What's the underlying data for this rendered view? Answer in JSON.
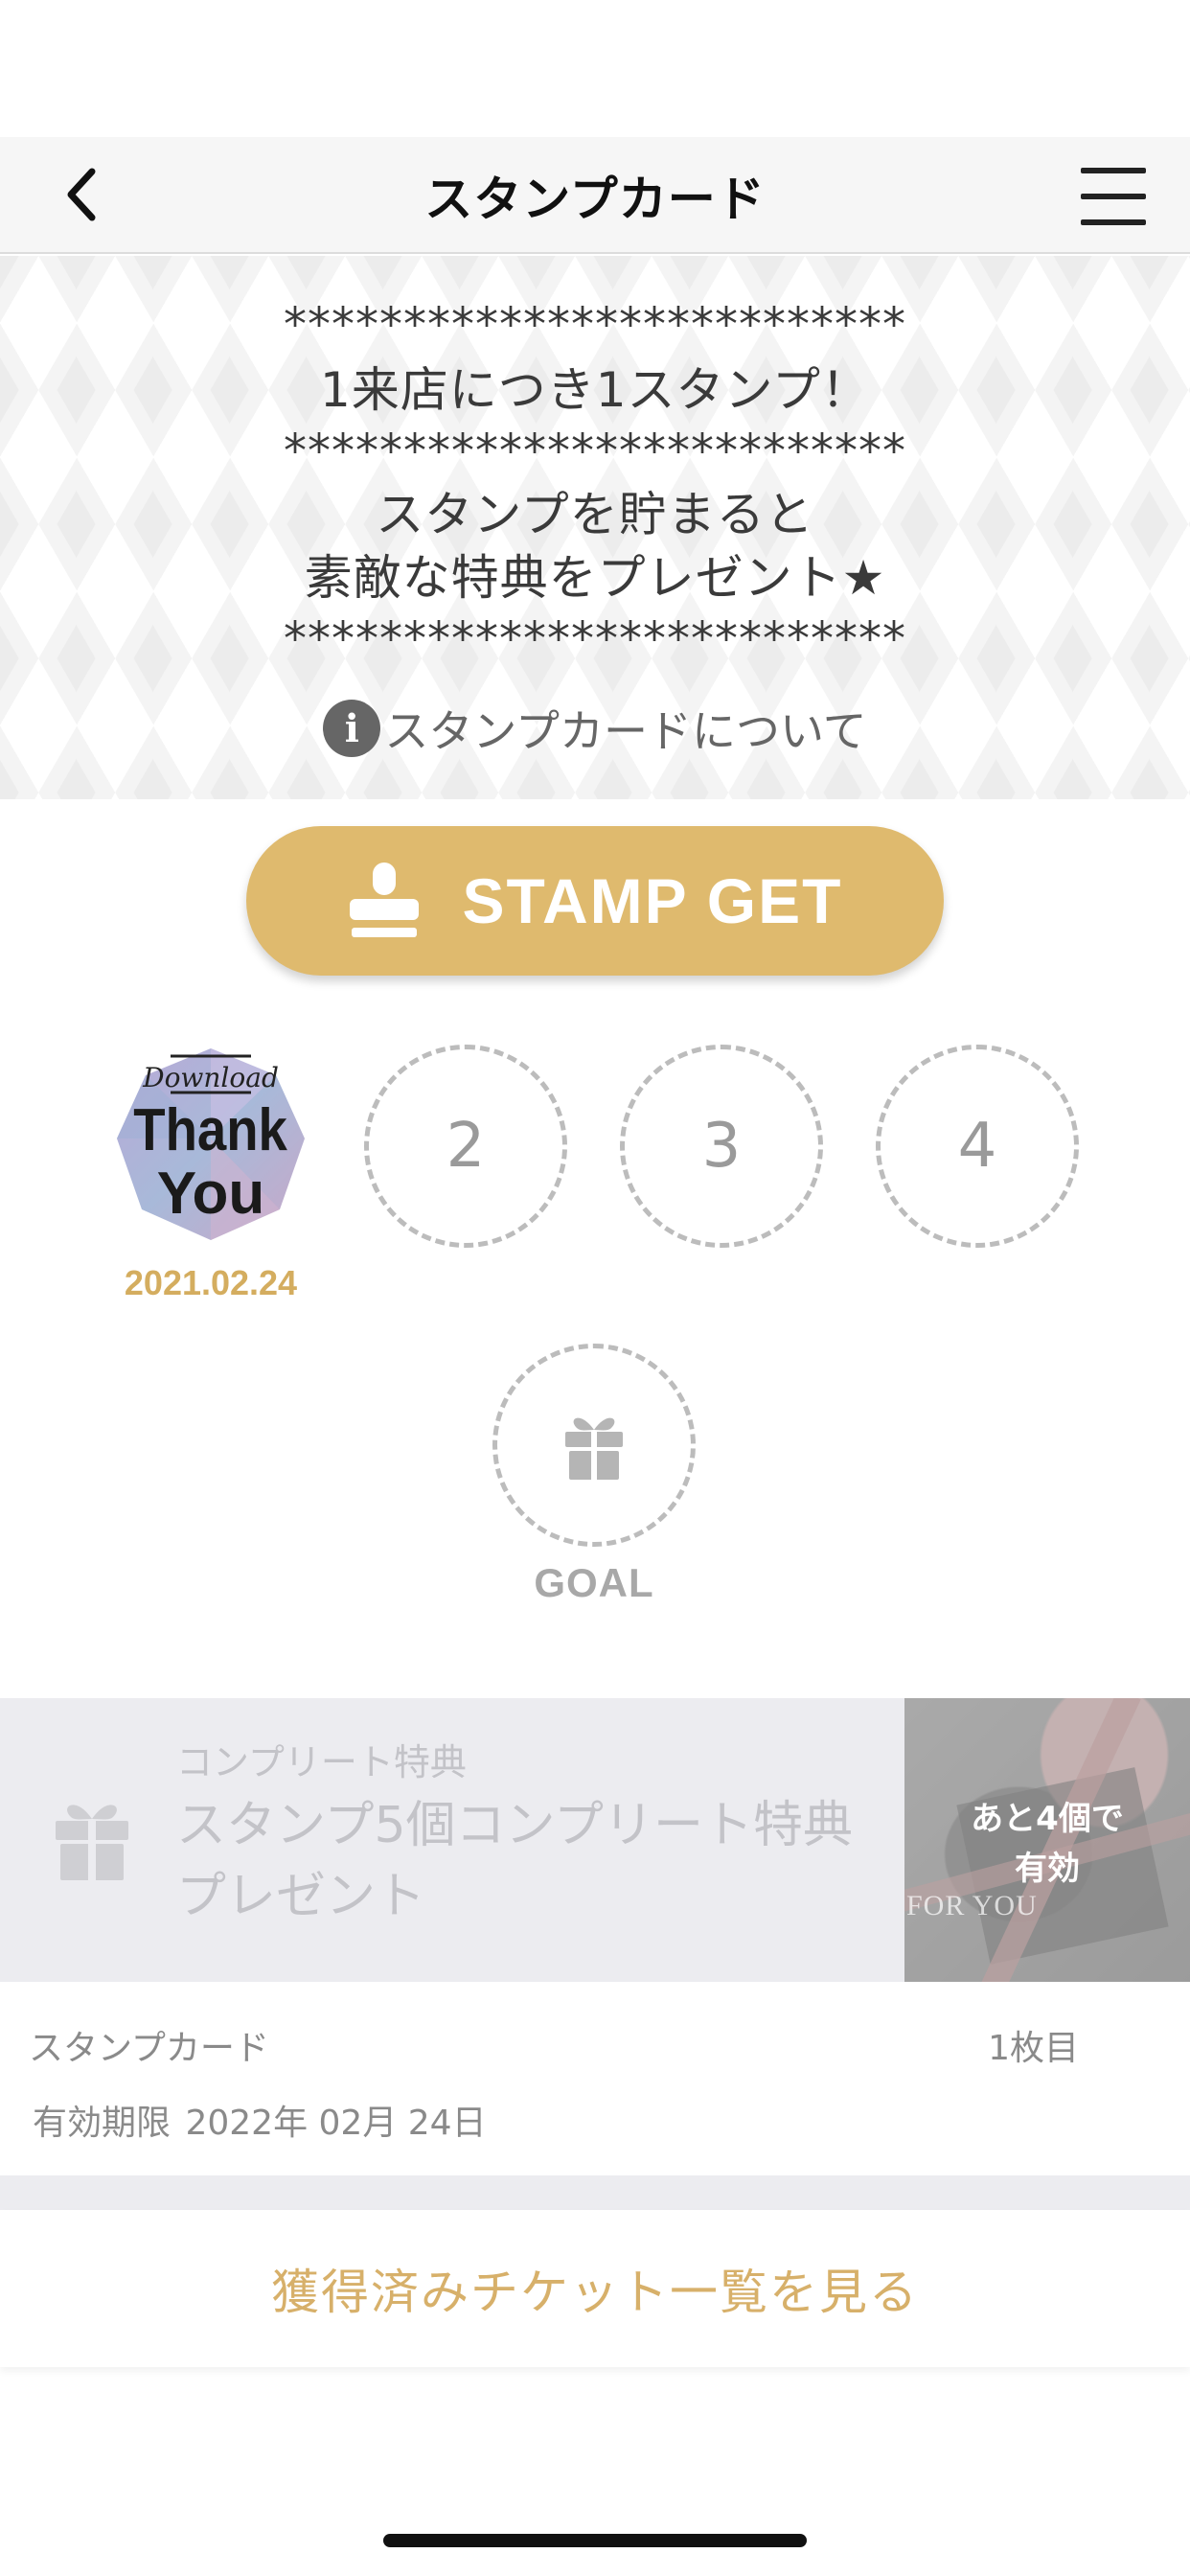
{
  "header": {
    "title": "スタンプカード",
    "back_icon": "chevron-left-icon",
    "menu_icon": "hamburger-menu-icon"
  },
  "banner": {
    "separator": "**************************",
    "line1": "1来店につき1スタンプ！",
    "line2": "スタンプを貯まると",
    "line3": "素敵な特典をプレゼント★",
    "info_link": "スタンプカードについて"
  },
  "stamp_button": {
    "label": "STAMP GET",
    "icon": "stamp-icon"
  },
  "stamps": {
    "slot1_image_text": [
      "Download",
      "Thank",
      "You"
    ],
    "slot1_date": "2021.02.24",
    "slot2": "2",
    "slot3": "3",
    "slot4": "4",
    "goal_label": "GOAL",
    "goal_icon": "gift-icon"
  },
  "reward": {
    "caption": "コンプリート特典",
    "title": "スタンプ5個コンプリート特典プレゼント",
    "badge_line1": "あと4個で",
    "badge_line2": "有効",
    "image_text": "FOR YOU"
  },
  "card_info": {
    "name": "スタンプカード",
    "count": "1枚目",
    "expiry_label": "有効期限",
    "expiry_date": "2022年 02月 24日"
  },
  "ticket_link": "獲得済みチケット一覧を見る",
  "colors": {
    "accent_gold": "#dfba6e",
    "date_gold": "#d4ad5f",
    "link_gold": "#d7b06a"
  }
}
